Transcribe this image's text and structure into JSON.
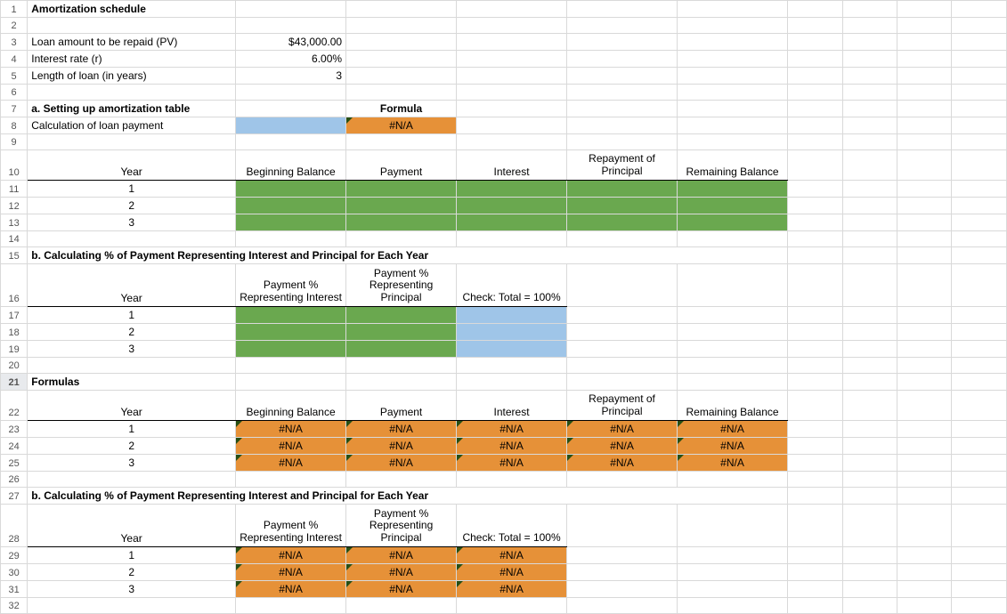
{
  "rows": {
    "1": {
      "A": "Amortization schedule"
    },
    "3": {
      "A": "Loan amount to be repaid (PV)",
      "B": "$43,000.00"
    },
    "4": {
      "A": "Interest rate  (r)",
      "B": "6.00%"
    },
    "5": {
      "A": "Length of loan (in years)",
      "B": "3"
    },
    "7": {
      "A": "a.  Setting up amortization table",
      "C": "Formula"
    },
    "8": {
      "A": "Calculation of loan payment",
      "C": "#N/A"
    },
    "10": {
      "A": "Year",
      "B": "Beginning Balance",
      "C": "Payment",
      "D": "Interest",
      "E": "Repayment of Principal",
      "F": "Remaining Balance"
    },
    "11": {
      "A": "1"
    },
    "12": {
      "A": "2"
    },
    "13": {
      "A": "3"
    },
    "15": {
      "A": "b.  Calculating % of Payment Representing Interest and Principal for Each Year"
    },
    "16": {
      "A": "Year",
      "B": "Payment % Representing Interest",
      "C": "Payment % Representing Principal",
      "D": "Check:  Total = 100%"
    },
    "17": {
      "A": "1"
    },
    "18": {
      "A": "2"
    },
    "19": {
      "A": "3"
    },
    "21": {
      "A": "Formulas"
    },
    "22": {
      "A": "Year",
      "B": "Beginning Balance",
      "C": "Payment",
      "D": "Interest",
      "E": "Repayment of Principal",
      "F": "Remaining Balance"
    },
    "23": {
      "A": "1",
      "B": "#N/A",
      "C": "#N/A",
      "D": "#N/A",
      "E": "#N/A",
      "F": "#N/A"
    },
    "24": {
      "A": "2",
      "B": "#N/A",
      "C": "#N/A",
      "D": "#N/A",
      "E": "#N/A",
      "F": "#N/A"
    },
    "25": {
      "A": "3",
      "B": "#N/A",
      "C": "#N/A",
      "D": "#N/A",
      "E": "#N/A",
      "F": "#N/A"
    },
    "27": {
      "A": "b.  Calculating % of Payment Representing Interest and Principal for Each Year"
    },
    "28": {
      "A": "Year",
      "B": "Payment % Representing Interest",
      "C": "Payment % Representing Principal",
      "D": "Check:  Total = 100%"
    },
    "29": {
      "A": "1",
      "B": "#N/A",
      "C": "#N/A",
      "D": "#N/A"
    },
    "30": {
      "A": "2",
      "B": "#N/A",
      "C": "#N/A",
      "D": "#N/A"
    },
    "31": {
      "A": "3",
      "B": "#N/A",
      "C": "#N/A",
      "D": "#N/A"
    }
  }
}
